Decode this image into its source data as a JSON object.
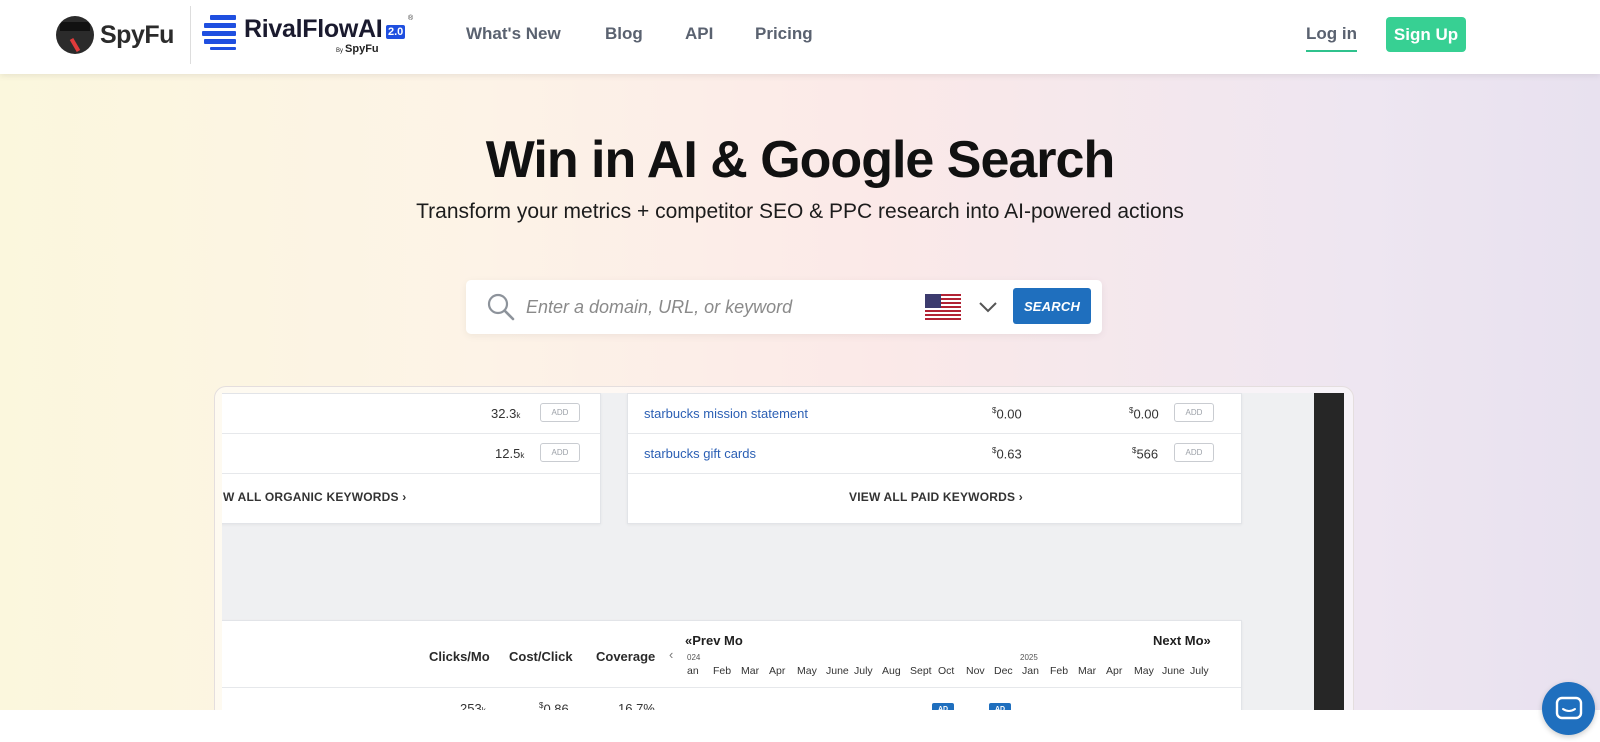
{
  "brand": {
    "spyfu_name": "SpyFu",
    "rival_name": "RivalFlowAI",
    "rival_version": "2.0",
    "rival_reg": "®",
    "rival_by_prefix": "By",
    "rival_by_name": "SpyFu",
    "brand_color": "#1f4fe0"
  },
  "nav": {
    "items": [
      "What's New",
      "Blog",
      "API",
      "Pricing"
    ],
    "login": "Log in",
    "signup": "Sign Up",
    "signup_color": "#37d093"
  },
  "hero": {
    "title": "Win in AI & Google Search",
    "subtitle": "Transform your metrics + competitor SEO & PPC research into AI-powered actions"
  },
  "search": {
    "placeholder": "Enter a domain, URL, or keyword",
    "value": "",
    "country_flag": "us-flag-icon",
    "button_label": "SEARCH",
    "button_color": "#1f6fbe"
  },
  "preview": {
    "organic_rows": [
      {
        "value": "32.3",
        "suffix": "k",
        "add": "ADD"
      },
      {
        "value": "12.5",
        "suffix": "k",
        "add": "ADD"
      }
    ],
    "organic_view_all": "W ALL ORGANIC KEYWORDS ›",
    "paid_rows": [
      {
        "keyword": "starbucks mission statement",
        "cpc_sym": "$",
        "cpc": "0.00",
        "cost_sym": "$",
        "cost": "0.00",
        "add": "ADD"
      },
      {
        "keyword": "starbucks gift cards",
        "cpc_sym": "$",
        "cpc": "0.63",
        "cost_sym": "$",
        "cost": "566",
        "add": "ADD"
      }
    ],
    "paid_view_all": "VIEW ALL PAID KEYWORDS ›",
    "table": {
      "headers": [
        "Clicks/Mo",
        "Cost/Click",
        "Coverage"
      ],
      "prev": "«Prev Mo",
      "next": "Next Mo»",
      "chev_left": "‹",
      "year_2024": "024",
      "year_2025": "2025",
      "months": [
        "an",
        "Feb",
        "Mar",
        "Apr",
        "May",
        "June",
        "July",
        "Aug",
        "Sept",
        "Oct",
        "Nov",
        "Dec",
        "Jan",
        "Feb",
        "Mar",
        "Apr",
        "May",
        "June",
        "July"
      ],
      "row": {
        "clicks": "253",
        "clicks_suffix": "k",
        "cpc_sym": "$",
        "cpc": "0.86",
        "coverage": "16.7%",
        "ad_label": "AD"
      }
    }
  }
}
